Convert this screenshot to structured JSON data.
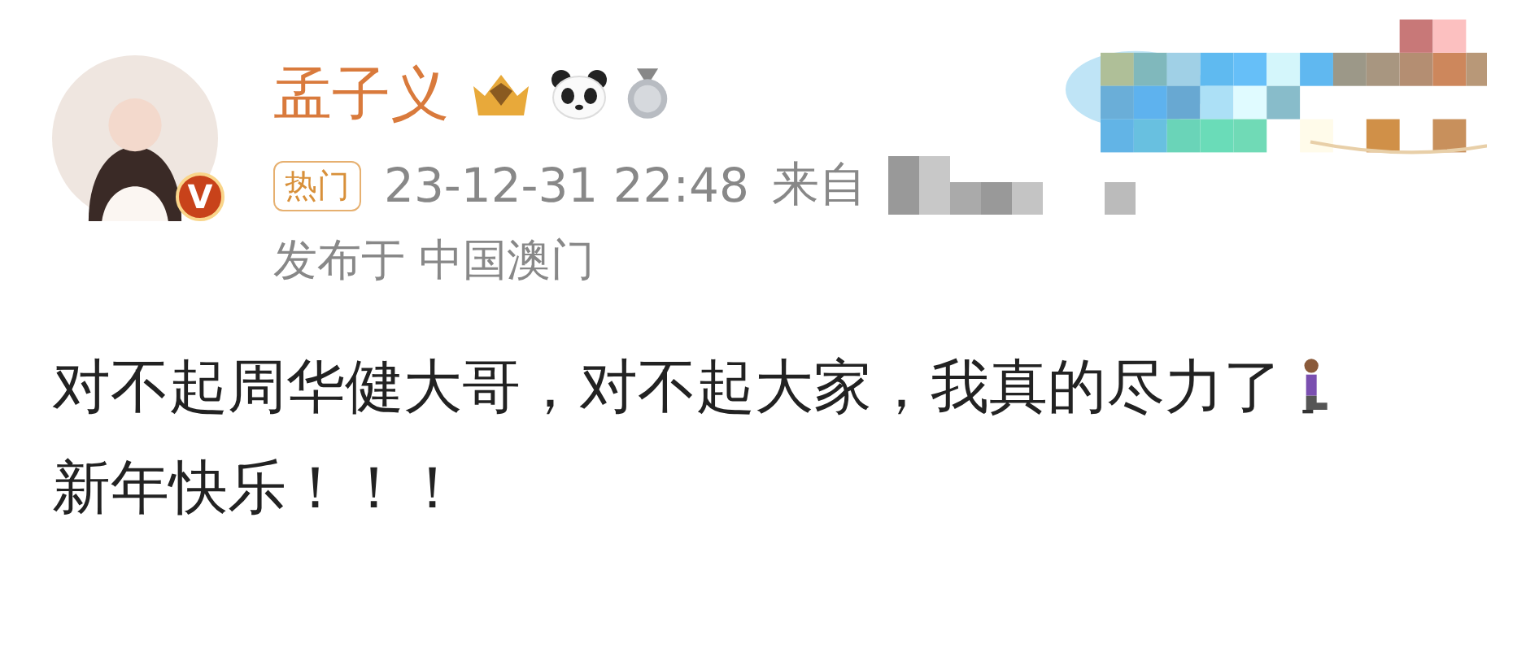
{
  "post": {
    "author": "孟子义",
    "verified_mark": "V",
    "hot_tag": "热门",
    "time": "23-12-31 22:48",
    "source_label": "来自",
    "location": "发布于 中国澳门",
    "content": [
      "对不起周华健大哥，对不起大家，我真的尽力了",
      "新年快乐！！！"
    ]
  }
}
